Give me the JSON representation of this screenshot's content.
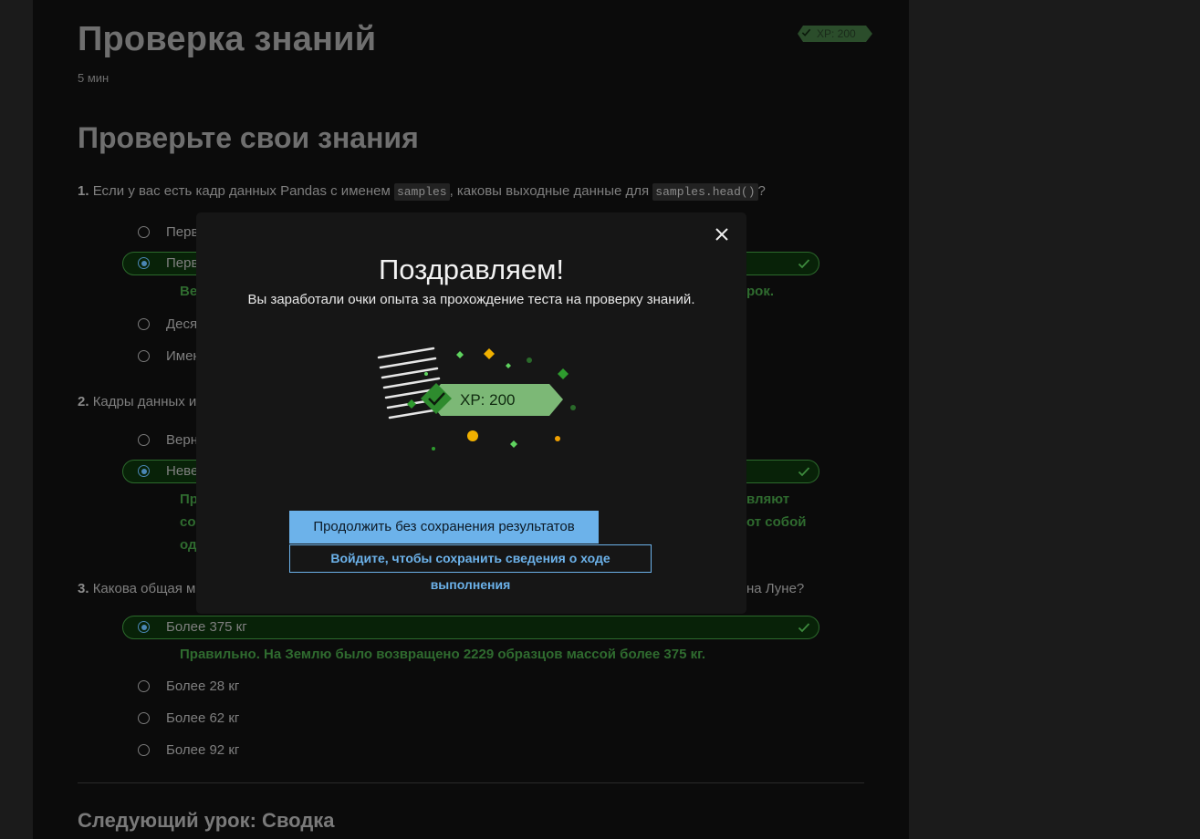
{
  "page": {
    "title": "Проверка знаний",
    "duration": "5 мин",
    "xp_badge": "XP: 200",
    "section_title": "Проверьте свои знания",
    "next_lesson": "Следующий урок: Сводка"
  },
  "questions": [
    {
      "number": "1.",
      "text_before": "Если у вас есть кадр данных Pandas с именем ",
      "code1": "samples",
      "text_middle": ", каковы выходные данные для ",
      "code2": "samples.head()",
      "text_after": "?",
      "options": [
        "Перв",
        "Перв",
        "Деся",
        "Имен"
      ],
      "feedback_line": "Ве",
      "feedback_tail": "рок."
    },
    {
      "number": "2.",
      "text": "Кадры данных и",
      "options": [
        "Верн",
        "Неве"
      ],
      "feedback_lines": [
        "Пр",
        "со",
        "од"
      ],
      "feedback_tails": [
        "вляют",
        "от собой"
      ]
    },
    {
      "number": "3.",
      "text": "Какова общая м",
      "text_tail": "на Луне?",
      "options": [
        "Более 375 кг",
        "Более 28 кг",
        "Более 62 кг",
        "Более 92 кг"
      ],
      "feedback": "Правильно. На Землю было возвращено 2229 образцов массой более 375 кг."
    }
  ],
  "modal": {
    "title": "Поздравляем!",
    "subtitle": "Вы заработали очки опыта за прохождение теста на проверку знаний.",
    "xp_label": "XP: 200",
    "primary_button": "Продолжить без сохранения результатов",
    "secondary_button": "Войдите, чтобы сохранить сведения о ходе выполнения"
  },
  "colors": {
    "correct_green": "#2f6b2f",
    "accent_blue": "#6cb2ea",
    "xp_green": "#7cb876"
  }
}
